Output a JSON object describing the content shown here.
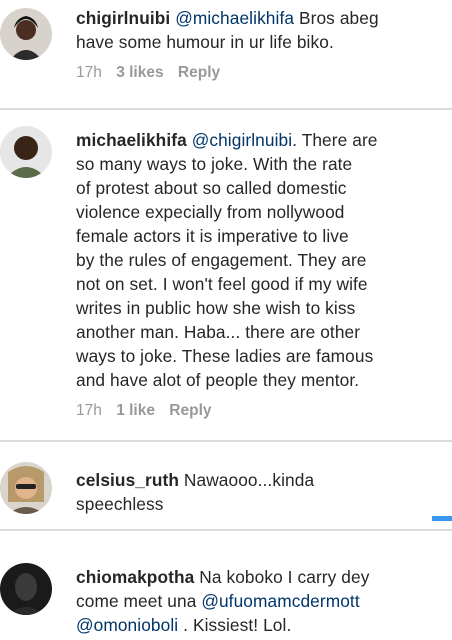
{
  "comments": [
    {
      "username": "chigirlnuibi",
      "mention": "@michaelikhifa",
      "lines": [
        "Bros abeg",
        "have some humour in ur life biko."
      ],
      "time": "17h",
      "likes": "3 likes",
      "reply": "Reply"
    },
    {
      "username": "michaelikhifa",
      "mention": "@chigirlnuibi",
      "lines": [
        ". There are",
        "so many ways to joke.  With the rate",
        "of protest about so called domestic",
        "violence expecially from nollywood",
        "female actors it is imperative to live",
        "by the rules of engagement.  They are",
        "not on set. I won't feel good if my wife",
        "writes in public how she wish to kiss",
        "another man. Haba... there are other",
        "ways to joke. These ladies are famous",
        "and have alot of people they mentor."
      ],
      "time": "17h",
      "likes": "1 like",
      "reply": "Reply"
    },
    {
      "username": "celsius_ruth",
      "lines": [
        "Nawaooo...kinda",
        "speechless"
      ]
    },
    {
      "username": "chiomakpotha",
      "lines": [
        "Na koboko I carry dey",
        "come meet una"
      ],
      "mention1": "@ufuomamcdermott",
      "mention2": "@omonioboli",
      "tail": " . Kissiest! Lol."
    }
  ],
  "colors": {
    "text": "#262626",
    "mention": "#003569",
    "meta": "#999999",
    "divider": "#dbdbdb",
    "accent": "#3897f0"
  }
}
